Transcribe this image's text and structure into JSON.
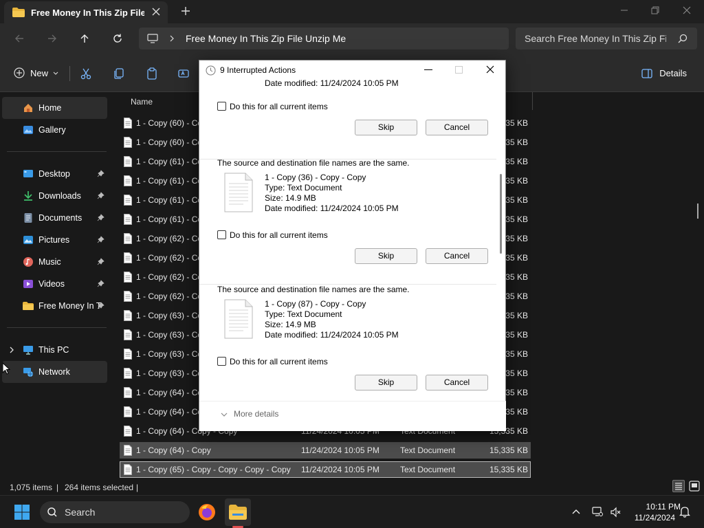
{
  "window": {
    "tab_title": "Free Money In This Zip File Un",
    "address_path": "Free Money In This Zip File Unzip Me",
    "search_placeholder": "Search Free Money In This Zip File",
    "accent": "#e8b53c"
  },
  "command_bar": {
    "new_label": "New",
    "details_label": "Details",
    "icons": [
      "cut-icon",
      "copy-icon",
      "paste-icon",
      "rename-icon"
    ]
  },
  "sidebar": {
    "items": [
      {
        "label": "Home",
        "icon": "home-icon",
        "selected": true
      },
      {
        "label": "Gallery",
        "icon": "gallery-icon"
      },
      {
        "label": "Desktop",
        "icon": "desktop-icon",
        "pinned": true
      },
      {
        "label": "Downloads",
        "icon": "downloads-icon",
        "pinned": true
      },
      {
        "label": "Documents",
        "icon": "documents-icon",
        "pinned": true
      },
      {
        "label": "Pictures",
        "icon": "pictures-icon",
        "pinned": true
      },
      {
        "label": "Music",
        "icon": "music-icon",
        "pinned": true
      },
      {
        "label": "Videos",
        "icon": "videos-icon",
        "pinned": true
      },
      {
        "label": "Free Money In T",
        "icon": "folder-icon",
        "pinned": true
      },
      {
        "label": "This PC",
        "icon": "this-pc-icon"
      },
      {
        "label": "Network",
        "icon": "network-icon"
      }
    ]
  },
  "file_list": {
    "column_name": "Name",
    "rows": [
      {
        "name": "1 - Copy (60) - Co",
        "date": "",
        "type": "",
        "size": "335 KB"
      },
      {
        "name": "1 - Copy (60) - Co",
        "date": "",
        "type": "",
        "size": "335 KB"
      },
      {
        "name": "1 - Copy (61) - Co",
        "date": "",
        "type": "",
        "size": "335 KB"
      },
      {
        "name": "1 - Copy (61) - Co",
        "date": "",
        "type": "",
        "size": "335 KB"
      },
      {
        "name": "1 - Copy (61) - Co",
        "date": "",
        "type": "",
        "size": "335 KB"
      },
      {
        "name": "1 - Copy (61) - Co",
        "date": "",
        "type": "",
        "size": "335 KB"
      },
      {
        "name": "1 - Copy (62) - Co",
        "date": "",
        "type": "",
        "size": "335 KB"
      },
      {
        "name": "1 - Copy (62) - Co",
        "date": "",
        "type": "",
        "size": "335 KB"
      },
      {
        "name": "1 - Copy (62) - Co",
        "date": "",
        "type": "",
        "size": "335 KB"
      },
      {
        "name": "1 - Copy (62) - Co",
        "date": "",
        "type": "",
        "size": "335 KB"
      },
      {
        "name": "1 - Copy (63) - Co",
        "date": "",
        "type": "",
        "size": "335 KB"
      },
      {
        "name": "1 - Copy (63) - Co",
        "date": "",
        "type": "",
        "size": "335 KB"
      },
      {
        "name": "1 - Copy (63) - Co",
        "date": "",
        "type": "",
        "size": "335 KB"
      },
      {
        "name": "1 - Copy (63) - Co",
        "date": "",
        "type": "",
        "size": "335 KB"
      },
      {
        "name": "1 - Copy (64) - Co",
        "date": "",
        "type": "",
        "size": "335 KB"
      },
      {
        "name": "1 - Copy (64) - Co",
        "date": "",
        "type": "",
        "size": "335 KB"
      },
      {
        "name": "1 - Copy (64) - Copy - Copy",
        "date": "11/24/2024 10:05 PM",
        "type": "Text Document",
        "size": "15,335 KB"
      },
      {
        "name": "1 - Copy (64) - Copy",
        "date": "11/24/2024 10:05 PM",
        "type": "Text Document",
        "size": "15,335 KB",
        "selected": true
      },
      {
        "name": "1 - Copy (65) - Copy - Copy - Copy - Copy",
        "date": "11/24/2024 10:05 PM",
        "type": "Text Document",
        "size": "15,335 KB",
        "selected": true,
        "focused": true
      }
    ]
  },
  "status_bar": {
    "item_count": "1,075 items",
    "selected": "264 items selected",
    "sep": "|"
  },
  "taskbar": {
    "search_label": "Search",
    "time": "10:11 PM",
    "date": "11/24/2024"
  },
  "dialog": {
    "title": "9 Interrupted Actions",
    "partial_date": "Date modified: 11/24/2024 10:05 PM",
    "checkbox_label": "Do this for all current items",
    "skip_label": "Skip",
    "cancel_label": "Cancel",
    "more_details": "More details",
    "conflicts": [
      {
        "message": "The source and destination file names are the same.",
        "name": "1 - Copy (36) - Copy - Copy",
        "type": "Type: Text Document",
        "size": "Size: 14.9 MB",
        "date": "Date modified: 11/24/2024 10:05 PM"
      },
      {
        "message": "The source and destination file names are the same.",
        "name": "1 - Copy (87) - Copy - Copy",
        "type": "Type: Text Document",
        "size": "Size: 14.9 MB",
        "date": "Date modified: 11/24/2024 10:05 PM"
      }
    ]
  }
}
